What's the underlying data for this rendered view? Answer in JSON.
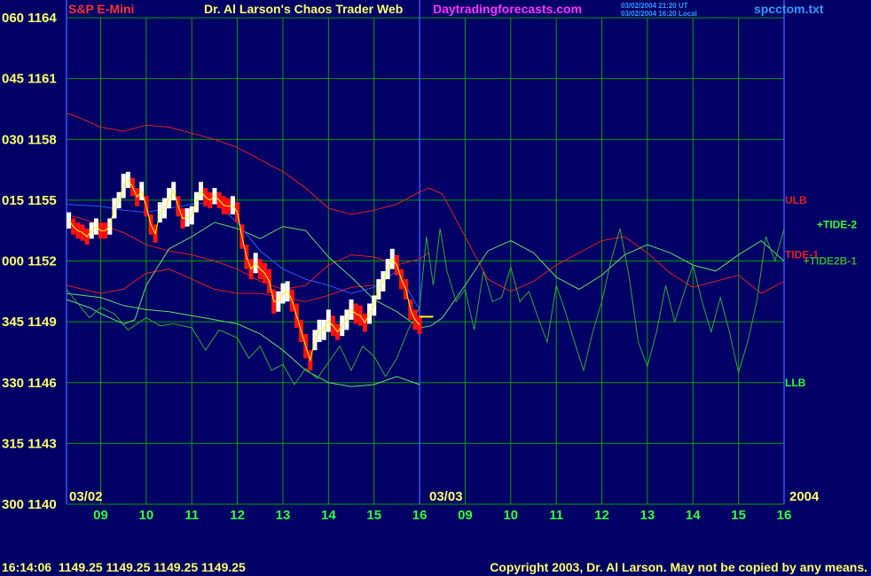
{
  "header": {
    "instrument": "S&P E-Mini",
    "title": "Dr. Al Larson's Chaos Trader Web",
    "site": "Daytradingforecasts.com",
    "stamp_ut": "03/02/2004 21:20 UT",
    "stamp_local": "03/02/2004 16:20 Local",
    "filename": "spcctom.txt"
  },
  "footer": {
    "readout": "16:14:06  1149.25 1149.25 1149.25 1149.25",
    "copyright": "Copyright 2003, Dr. Al Larson. May not be copied by any means."
  },
  "colors": {
    "background": "#000066",
    "grid": "#00a000",
    "text_yellow": "#ffff66",
    "title_red": "#ff3030",
    "site_magenta": "#ff33ff",
    "stamp_blue": "#3399ff",
    "red_band": "#e02020",
    "green_band": "#66dd66",
    "tide_green": "#33aa33",
    "ma_blue": "#3355ff",
    "label_green": "#33ff33",
    "bar_white": "#ffffff",
    "bar_red": "#ff1111",
    "close_yellow": "#ffff00"
  },
  "chart_data": {
    "type": "line",
    "title": "S&P E-Mini",
    "xlabel": "",
    "ylabel": "",
    "ylim": [
      1140,
      1164
    ],
    "y_ticks": [
      {
        "code": "060",
        "price": "1164",
        "value": 1164
      },
      {
        "code": "045",
        "price": "1161",
        "value": 1161
      },
      {
        "code": "030",
        "price": "1158",
        "value": 1158
      },
      {
        "code": "015",
        "price": "1155",
        "value": 1155
      },
      {
        "code": "000",
        "price": "1152",
        "value": 1152
      },
      {
        "code": "345",
        "price": "1149",
        "value": 1149
      },
      {
        "code": "330",
        "price": "1146",
        "value": 1146
      },
      {
        "code": "315",
        "price": "1143",
        "value": 1143
      },
      {
        "code": "300",
        "price": "1140",
        "value": 1140
      }
    ],
    "xlim": [
      8.25,
      24.0
    ],
    "x_ticks": [
      {
        "label": "09",
        "x": 9
      },
      {
        "label": "10",
        "x": 10
      },
      {
        "label": "11",
        "x": 11
      },
      {
        "label": "12",
        "x": 12
      },
      {
        "label": "13",
        "x": 13
      },
      {
        "label": "14",
        "x": 14
      },
      {
        "label": "15",
        "x": 15
      },
      {
        "label": "16",
        "x": 16
      },
      {
        "label": "09",
        "x": 17
      },
      {
        "label": "10",
        "x": 18
      },
      {
        "label": "11",
        "x": 19
      },
      {
        "label": "12",
        "x": 20
      },
      {
        "label": "13",
        "x": 21
      },
      {
        "label": "14",
        "x": 22
      },
      {
        "label": "15",
        "x": 23
      },
      {
        "label": "16",
        "x": 24
      }
    ],
    "date_labels": [
      "03/02",
      "03/03",
      "2004"
    ],
    "series_labels": [
      {
        "text": "ULB",
        "y": 1155.0,
        "color": "red_band"
      },
      {
        "text": "+TIDE-2",
        "y": 1153.8,
        "color": "label_green"
      },
      {
        "text": "TIDE-1",
        "y": 1152.3,
        "color": "red_band"
      },
      {
        "text": "+TIDE2B-1",
        "y": 1152.0,
        "color": "tide_green"
      },
      {
        "text": "LLB",
        "y": 1146.0,
        "color": "label_green"
      }
    ],
    "series": [
      {
        "name": "ULB",
        "color": "red_band",
        "x": [
          8.25,
          8.5,
          9,
          9.5,
          10,
          10.5,
          11,
          11.5,
          12,
          12.5,
          13,
          13.5,
          14,
          14.5,
          15,
          15.5,
          16,
          16.2,
          16.5,
          17,
          17.5,
          18,
          18.5,
          19,
          19.5,
          20,
          20.5,
          21,
          21.5,
          22,
          22.5,
          23,
          23.5,
          24
        ],
        "y": [
          1159.3,
          1159.1,
          1158.6,
          1158.4,
          1158.7,
          1158.6,
          1158.3,
          1158.0,
          1157.6,
          1157.0,
          1156.4,
          1155.6,
          1154.6,
          1154.3,
          1154.5,
          1154.8,
          1155.4,
          1155.6,
          1155.3,
          1153.2,
          1151.1,
          1150.5,
          1151.0,
          1151.8,
          1152.4,
          1153.0,
          1153.2,
          1152.4,
          1151.4,
          1150.7,
          1151.0,
          1151.3,
          1150.4,
          1151.0
        ]
      },
      {
        "name": "TIDE-1",
        "color": "red_band",
        "x": [
          8.25,
          9,
          9.5,
          10,
          10.5,
          11,
          11.5,
          12,
          12.5,
          13,
          13.5,
          14,
          14.5,
          15,
          15.5,
          16,
          16.2
        ],
        "y": [
          1154.3,
          1153.8,
          1153.4,
          1152.8,
          1152.5,
          1152.3,
          1152.0,
          1151.6,
          1151.0,
          1150.6,
          1150.8,
          1151.8,
          1152.3,
          1152.2,
          1151.8,
          1152.1,
          1152.4
        ]
      },
      {
        "name": "TIDE-1 lower",
        "color": "red_band",
        "x": [
          8.25,
          9,
          9.5,
          10,
          10.5,
          11,
          11.5,
          12,
          12.5,
          13,
          13.5,
          14,
          14.5,
          15
        ],
        "y": [
          1150.8,
          1150.4,
          1150.6,
          1151.4,
          1151.6,
          1151.1,
          1150.6,
          1150.4,
          1150.4,
          1150.2,
          1150.0,
          1150.3,
          1150.7,
          1150.8
        ]
      },
      {
        "name": "TIDE-2",
        "color": "green_band",
        "x": [
          8.25,
          8.75,
          9,
          9.5,
          9.75,
          10,
          10.5,
          11,
          11.5,
          12,
          12.5,
          13,
          13.5,
          14,
          14.5,
          15,
          15.5,
          16,
          16.25,
          16.5,
          17,
          17.5,
          18,
          18.5,
          19,
          19.5,
          20,
          20.5,
          21,
          21.5,
          22,
          22.5,
          23,
          23.5,
          24
        ],
        "y": [
          1150.1,
          1149.7,
          1149.4,
          1148.9,
          1149.1,
          1150.8,
          1152.6,
          1153.2,
          1153.9,
          1153.6,
          1153.1,
          1153.7,
          1153.5,
          1152.2,
          1151.2,
          1150.1,
          1149.5,
          1148.7,
          1148.8,
          1149.2,
          1150.8,
          1152.5,
          1153.0,
          1152.4,
          1151.2,
          1150.6,
          1151.3,
          1152.3,
          1152.8,
          1152.4,
          1151.8,
          1151.5,
          1152.3,
          1153.0,
          1152.0
        ]
      },
      {
        "name": "LLB",
        "color": "green_band",
        "x": [
          8.25,
          9,
          9.5,
          10,
          10.5,
          11,
          11.5,
          12,
          12.5,
          13,
          13.5,
          14,
          14.5,
          15,
          15.5,
          16
        ],
        "y": [
          1150.4,
          1150.2,
          1149.8,
          1149.6,
          1149.5,
          1149.3,
          1149.1,
          1148.9,
          1148.4,
          1147.6,
          1146.6,
          1146.0,
          1145.8,
          1145.9,
          1146.3,
          1145.9
        ]
      },
      {
        "name": "MA",
        "color": "ma_blue",
        "x": [
          8.25,
          9,
          9.5,
          10,
          10.5,
          11,
          11.5,
          12,
          12.5,
          13,
          13.5,
          14,
          14.5,
          15,
          15.5,
          16
        ],
        "y": [
          1154.8,
          1154.7,
          1154.5,
          1154.4,
          1154.6,
          1154.8,
          1154.9,
          1153.9,
          1152.5,
          1151.6,
          1151.1,
          1150.8,
          1150.4,
          1150.7,
          1151.5,
          1149.6
        ]
      },
      {
        "name": "+TIDE2B-1",
        "color": "tide_green",
        "x": [
          8.25,
          8.5,
          8.75,
          9,
          9.3,
          9.6,
          10,
          10.3,
          10.6,
          11,
          11.3,
          11.6,
          12,
          12.25,
          12.5,
          12.75,
          13,
          13.25,
          13.5,
          13.75,
          14,
          14.25,
          14.5,
          14.75,
          15,
          15.25,
          15.5,
          15.75,
          16,
          16.15,
          16.3,
          16.45,
          16.6,
          16.8,
          17,
          17.2,
          17.4,
          17.6,
          17.8,
          18,
          18.2,
          18.4,
          18.6,
          18.8,
          19,
          19.2,
          19.4,
          19.6,
          19.8,
          20,
          20.2,
          20.4,
          20.6,
          20.8,
          21,
          21.2,
          21.4,
          21.6,
          21.8,
          22,
          22.2,
          22.4,
          22.6,
          22.8,
          23,
          23.2,
          23.4,
          23.6,
          23.8,
          24
        ],
        "y": [
          1150.6,
          1149.9,
          1149.2,
          1149.7,
          1149.4,
          1148.6,
          1149.2,
          1148.8,
          1148.9,
          1148.7,
          1147.6,
          1148.6,
          1148.2,
          1147.2,
          1147.8,
          1146.6,
          1146.9,
          1145.9,
          1146.7,
          1146.2,
          1147.0,
          1147.8,
          1146.6,
          1147.8,
          1147.3,
          1146.3,
          1147.2,
          1148.6,
          1149.7,
          1153.2,
          1150.8,
          1153.6,
          1151.5,
          1150.0,
          1150.6,
          1148.6,
          1151.5,
          1150.0,
          1150.2,
          1151.7,
          1150.0,
          1150.5,
          1149.2,
          1148.0,
          1150.8,
          1149.5,
          1148.0,
          1146.6,
          1148.5,
          1150.0,
          1152.0,
          1153.6,
          1151.2,
          1148.0,
          1146.8,
          1148.5,
          1150.8,
          1149.0,
          1150.4,
          1151.8,
          1150.0,
          1148.5,
          1150.2,
          1148.5,
          1146.5,
          1148.0,
          1150.0,
          1153.2,
          1152.0,
          1153.6
        ]
      }
    ],
    "price_bars": {
      "x": [
        8.3,
        8.4,
        8.5,
        8.6,
        8.7,
        8.8,
        8.9,
        9.0,
        9.1,
        9.2,
        9.3,
        9.4,
        9.5,
        9.6,
        9.7,
        9.8,
        9.9,
        10.0,
        10.1,
        10.2,
        10.3,
        10.4,
        10.5,
        10.6,
        10.7,
        10.8,
        10.9,
        11.0,
        11.1,
        11.2,
        11.3,
        11.4,
        11.5,
        11.6,
        11.7,
        11.8,
        11.9,
        12.0,
        12.1,
        12.2,
        12.3,
        12.4,
        12.5,
        12.6,
        12.7,
        12.8,
        12.9,
        13.0,
        13.1,
        13.2,
        13.3,
        13.4,
        13.5,
        13.6,
        13.7,
        13.8,
        13.9,
        14.0,
        14.1,
        14.2,
        14.3,
        14.4,
        14.5,
        14.6,
        14.7,
        14.8,
        14.9,
        15.0,
        15.1,
        15.2,
        15.3,
        15.4,
        15.5,
        15.6,
        15.7,
        15.8,
        15.9,
        16.0
      ],
      "high": [
        1154.4,
        1154.1,
        1153.9,
        1153.8,
        1153.6,
        1153.9,
        1154.1,
        1153.9,
        1153.9,
        1154.1,
        1155.1,
        1155.4,
        1156.3,
        1156.4,
        1156.1,
        1155.6,
        1155.9,
        1155.2,
        1154.3,
        1153.8,
        1154.9,
        1155.1,
        1155.6,
        1155.9,
        1155.2,
        1154.6,
        1154.6,
        1154.7,
        1155.4,
        1155.9,
        1155.6,
        1155.4,
        1155.6,
        1155.4,
        1155.2,
        1155.1,
        1155.2,
        1154.9,
        1153.8,
        1152.8,
        1152.1,
        1152.4,
        1152.1,
        1151.9,
        1151.6,
        1150.6,
        1150.5,
        1150.9,
        1151.0,
        1150.6,
        1149.9,
        1149.1,
        1148.4,
        1147.6,
        1148.6,
        1149.1,
        1149.1,
        1149.6,
        1149.3,
        1148.9,
        1149.3,
        1149.6,
        1150.1,
        1149.9,
        1149.8,
        1149.4,
        1149.9,
        1150.3,
        1151.1,
        1151.5,
        1152.1,
        1152.6,
        1152.3,
        1151.6,
        1151.1,
        1150.1,
        1149.6,
        1149.3
      ],
      "low": [
        1153.6,
        1153.3,
        1153.1,
        1153.0,
        1152.8,
        1153.1,
        1153.3,
        1153.1,
        1153.1,
        1153.3,
        1154.1,
        1154.6,
        1155.1,
        1155.6,
        1155.2,
        1154.7,
        1155.0,
        1154.2,
        1153.3,
        1152.9,
        1153.9,
        1154.1,
        1154.6,
        1155.0,
        1154.2,
        1153.6,
        1153.7,
        1153.8,
        1154.4,
        1155.0,
        1154.7,
        1154.6,
        1154.8,
        1154.6,
        1154.3,
        1154.3,
        1154.3,
        1153.9,
        1152.6,
        1151.6,
        1151.1,
        1151.4,
        1151.1,
        1150.9,
        1150.4,
        1149.4,
        1149.5,
        1149.9,
        1150.0,
        1149.5,
        1148.7,
        1148.0,
        1147.2,
        1146.6,
        1147.6,
        1148.0,
        1148.1,
        1148.5,
        1148.3,
        1148.1,
        1148.3,
        1148.6,
        1149.1,
        1148.9,
        1148.8,
        1148.5,
        1148.9,
        1149.3,
        1150.1,
        1150.5,
        1151.1,
        1151.6,
        1151.3,
        1150.6,
        1150.1,
        1149.1,
        1148.6,
        1148.4
      ],
      "direction": [
        "up",
        "down",
        "down",
        "down",
        "down",
        "up",
        "up",
        "down",
        "down",
        "up",
        "up",
        "up",
        "up",
        "up",
        "down",
        "down",
        "up",
        "down",
        "down",
        "down",
        "up",
        "up",
        "up",
        "up",
        "down",
        "down",
        "up",
        "up",
        "up",
        "up",
        "down",
        "down",
        "up",
        "down",
        "down",
        "down",
        "up",
        "down",
        "down",
        "down",
        "down",
        "up",
        "down",
        "down",
        "down",
        "down",
        "up",
        "up",
        "up",
        "down",
        "down",
        "down",
        "down",
        "down",
        "up",
        "up",
        "up",
        "up",
        "down",
        "down",
        "up",
        "up",
        "up",
        "down",
        "down",
        "down",
        "up",
        "up",
        "up",
        "up",
        "up",
        "up",
        "down",
        "down",
        "down",
        "down",
        "down",
        "down"
      ]
    },
    "close_marker": {
      "x_start": 16.0,
      "x_end": 16.3,
      "y": 1149.25
    },
    "vertical_markers": [
      8.25,
      16.0
    ]
  }
}
